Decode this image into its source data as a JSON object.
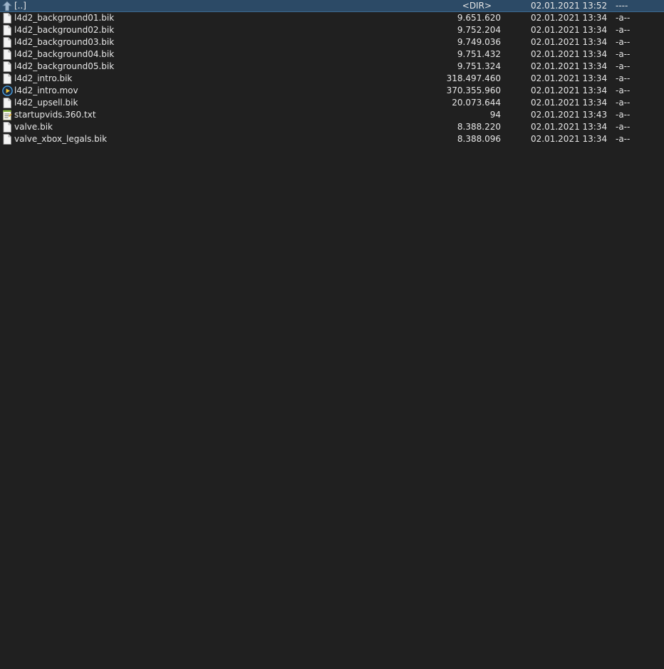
{
  "panel": {
    "items": [
      {
        "name": "[..]",
        "size": "<DIR>",
        "date": "02.01.2021 13:52",
        "attr": "----",
        "icon": "up-arrow-icon",
        "selected": true
      },
      {
        "name": "l4d2_background01.bik",
        "size": "9.651.620",
        "date": "02.01.2021 13:34",
        "attr": "-a--",
        "icon": "file-icon"
      },
      {
        "name": "l4d2_background02.bik",
        "size": "9.752.204",
        "date": "02.01.2021 13:34",
        "attr": "-a--",
        "icon": "file-icon"
      },
      {
        "name": "l4d2_background03.bik",
        "size": "9.749.036",
        "date": "02.01.2021 13:34",
        "attr": "-a--",
        "icon": "file-icon"
      },
      {
        "name": "l4d2_background04.bik",
        "size": "9.751.432",
        "date": "02.01.2021 13:34",
        "attr": "-a--",
        "icon": "file-icon"
      },
      {
        "name": "l4d2_background05.bik",
        "size": "9.751.324",
        "date": "02.01.2021 13:34",
        "attr": "-a--",
        "icon": "file-icon"
      },
      {
        "name": "l4d2_intro.bik",
        "size": "318.497.460",
        "date": "02.01.2021 13:34",
        "attr": "-a--",
        "icon": "file-icon"
      },
      {
        "name": "l4d2_intro.mov",
        "size": "370.355.960",
        "date": "02.01.2021 13:34",
        "attr": "-a--",
        "icon": "media-play-icon"
      },
      {
        "name": "l4d2_upsell.bik",
        "size": "20.073.644",
        "date": "02.01.2021 13:34",
        "attr": "-a--",
        "icon": "file-icon"
      },
      {
        "name": "startupvids.360.txt",
        "size": "94",
        "date": "02.01.2021 13:43",
        "attr": "-a--",
        "icon": "text-file-icon"
      },
      {
        "name": "valve.bik",
        "size": "8.388.220",
        "date": "02.01.2021 13:34",
        "attr": "-a--",
        "icon": "file-icon"
      },
      {
        "name": "valve_xbox_legals.bik",
        "size": "8.388.096",
        "date": "02.01.2021 13:34",
        "attr": "-a--",
        "icon": "file-icon"
      }
    ]
  },
  "colors": {
    "background": "#202020",
    "selection": "#2c4a66",
    "text": "#e6e6e6"
  }
}
